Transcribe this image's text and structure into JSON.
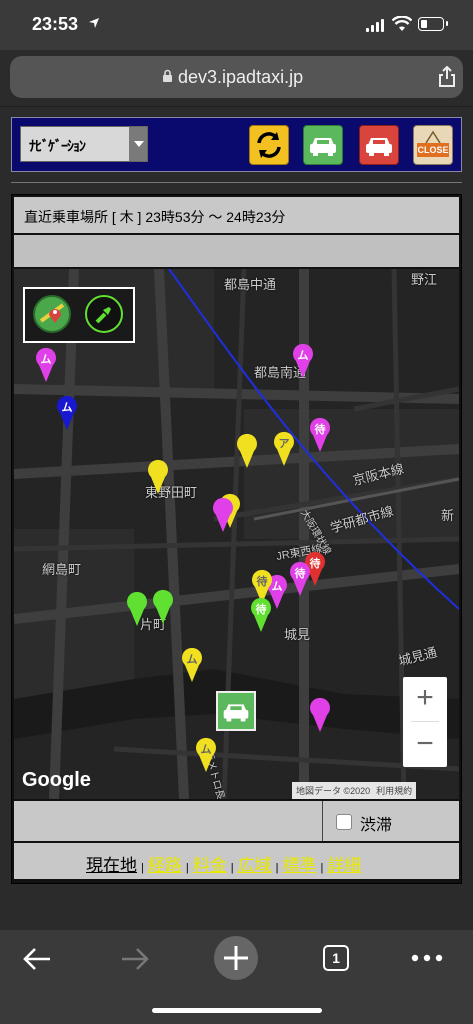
{
  "status": {
    "time": "23:53"
  },
  "browser": {
    "url": "dev3.ipadtaxi.jp",
    "tab_count": "1"
  },
  "navbar": {
    "select_label": "ﾅﾋﾞｹﾞｰｼｮﾝ",
    "close_label": "CLOSE"
  },
  "panel": {
    "header": "直近乗車場所 [ 木 ] 23時53分 〜 24時23分",
    "traffic_label": "渋滞",
    "links": [
      "現在地",
      "経路",
      "料金",
      "広域",
      "標準",
      "詳細"
    ]
  },
  "map": {
    "labels": [
      "都島中通",
      "都島南通",
      "東野田町",
      "京阪本線",
      "学研都市線",
      "JR東西線",
      "大阪環状線",
      "網島町",
      "片町",
      "城見",
      "城見通",
      "野江",
      "新",
      "大阪メトロ長堀鶴見"
    ],
    "google": "Google",
    "attribution": [
      "地図データ ©2020",
      "利用規約"
    ],
    "pins": [
      {
        "color": "#e040e8",
        "glyph": "ム"
      },
      {
        "color": "#1818d0",
        "glyph": "ム"
      },
      {
        "color": "#e040e8",
        "glyph": "ム"
      },
      {
        "color": "#e040e8",
        "glyph": "待"
      },
      {
        "color": "#f0e020",
        "glyph": ""
      },
      {
        "color": "#f0e020",
        "glyph": "ア"
      },
      {
        "color": "#f0e020",
        "glyph": ""
      },
      {
        "color": "#f0e020",
        "glyph": ""
      },
      {
        "color": "#e040e8",
        "glyph": ""
      },
      {
        "color": "#e03030",
        "glyph": "待"
      },
      {
        "color": "#e040e8",
        "glyph": "待"
      },
      {
        "color": "#e040e8",
        "glyph": "ム"
      },
      {
        "color": "#f0e020",
        "glyph": "待"
      },
      {
        "color": "#60e030",
        "glyph": "待"
      },
      {
        "color": "#60e030",
        "glyph": ""
      },
      {
        "color": "#60e030",
        "glyph": ""
      },
      {
        "color": "#f0e020",
        "glyph": "ム"
      },
      {
        "color": "#e040e8",
        "glyph": ""
      },
      {
        "color": "#f0e020",
        "glyph": "ム"
      }
    ]
  },
  "colors": {
    "nav_bg": "#0a0a6e",
    "link": "#e8e800"
  }
}
